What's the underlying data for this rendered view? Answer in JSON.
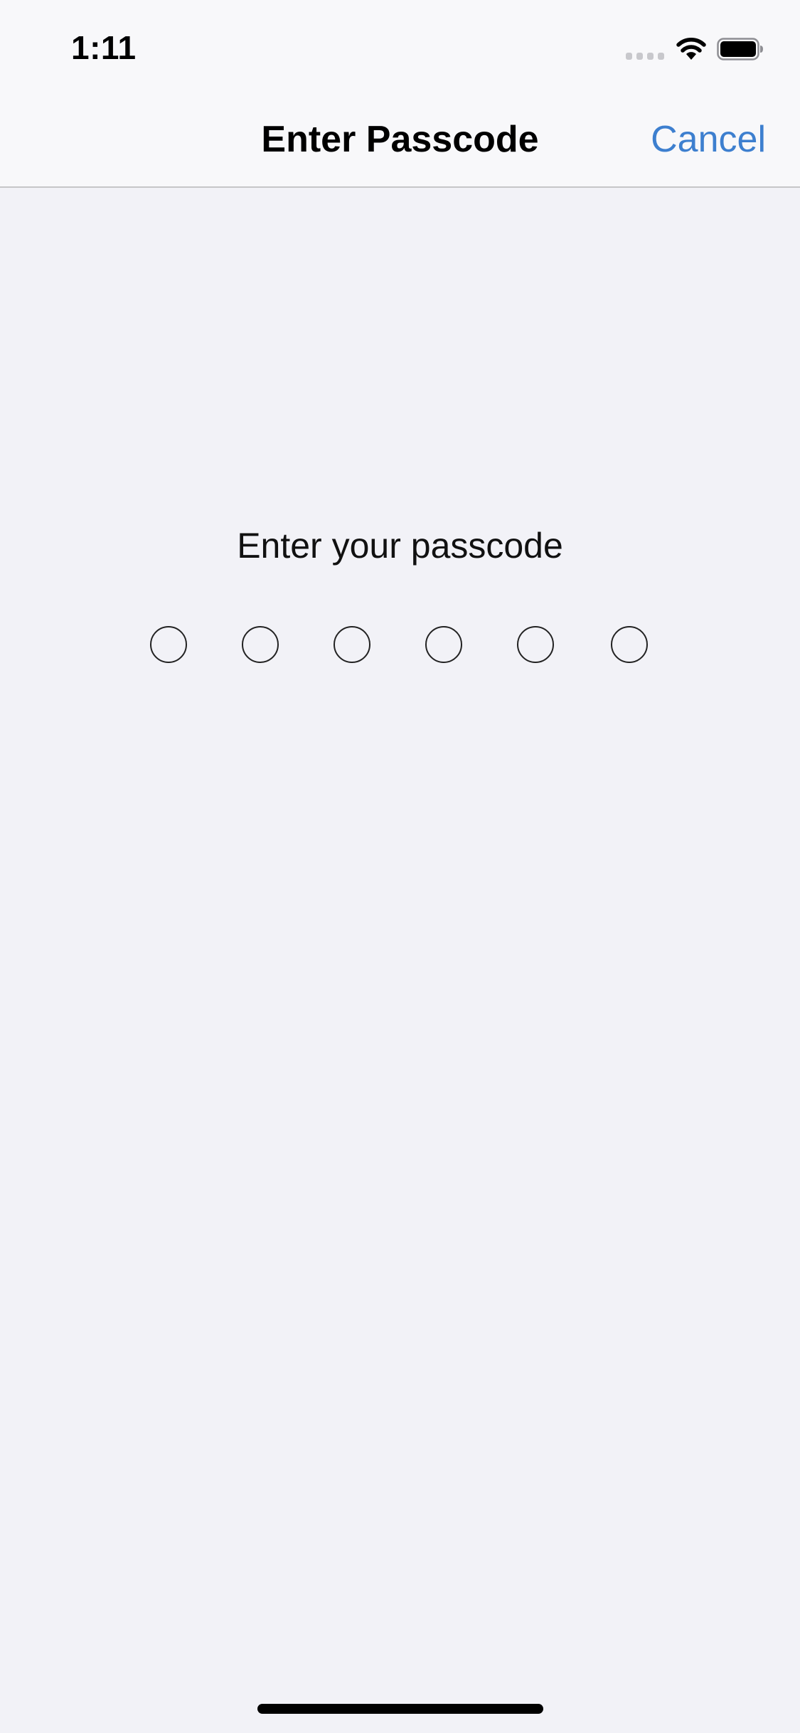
{
  "status_bar": {
    "time": "1:11",
    "signal_icon": "cellular-signal-icon",
    "wifi_icon": "wifi-icon",
    "battery_icon": "battery-icon"
  },
  "nav": {
    "title": "Enter Passcode",
    "cancel_label": "Cancel"
  },
  "passcode": {
    "prompt": "Enter your passcode",
    "length": 6,
    "entered": 0
  },
  "colors": {
    "accent": "#3d7fcf",
    "background": "#f2f2f7",
    "bar_background": "#f8f8fa"
  }
}
